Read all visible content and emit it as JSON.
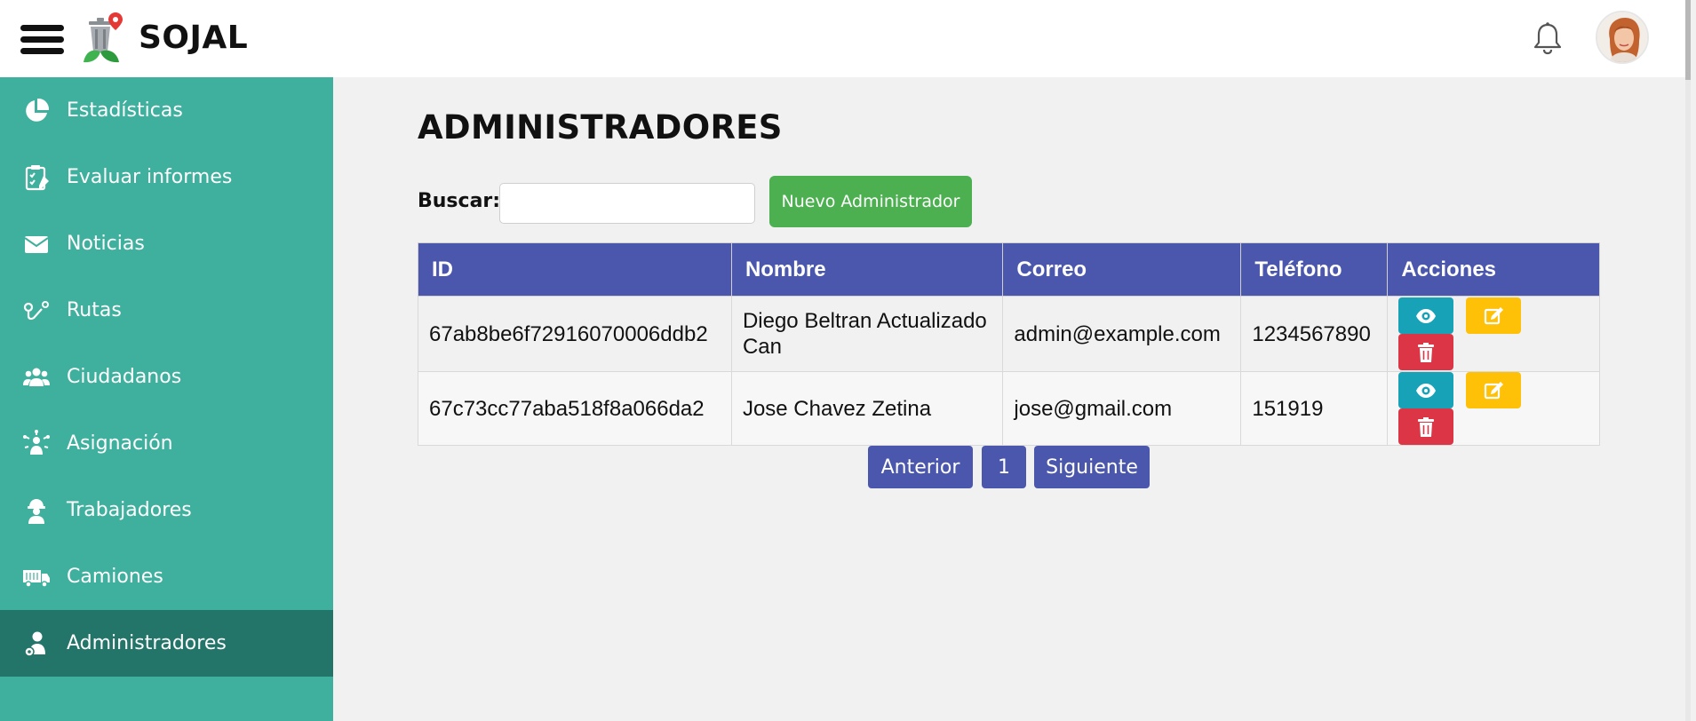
{
  "app": {
    "name": "SOJAL"
  },
  "icons": {
    "menu": "hamburger-icon",
    "logo": "trash-bin-location-logo",
    "notifications": "bell-icon",
    "user": "user-avatar"
  },
  "sidebar": {
    "items": [
      {
        "label": "Estadísticas",
        "icon": "pie-chart-icon",
        "active": false
      },
      {
        "label": "Evaluar informes",
        "icon": "clipboard-check-icon",
        "active": false
      },
      {
        "label": "Noticias",
        "icon": "envelope-icon",
        "active": false
      },
      {
        "label": "Rutas",
        "icon": "route-icon",
        "active": false
      },
      {
        "label": "Ciudadanos",
        "icon": "users-icon",
        "active": false
      },
      {
        "label": "Asignación",
        "icon": "assignment-icon",
        "active": false
      },
      {
        "label": "Trabajadores",
        "icon": "hard-hat-worker-icon",
        "active": false
      },
      {
        "label": "Camiones",
        "icon": "truck-icon",
        "active": false
      },
      {
        "label": "Administradores",
        "icon": "user-cog-icon",
        "active": true
      }
    ]
  },
  "main": {
    "title": "ADMINISTRADORES",
    "search": {
      "label": "Buscar:",
      "value": "",
      "placeholder": ""
    },
    "new_button": "Nuevo Administrador",
    "table": {
      "headers": [
        "ID",
        "Nombre",
        "Correo",
        "Teléfono",
        "Acciones"
      ],
      "rows": [
        {
          "id": "67ab8be6f72916070006ddb2",
          "nombre": "Diego Beltran Actualizado Can",
          "correo": "admin@example.com",
          "telefono": "1234567890"
        },
        {
          "id": "67c73cc77aba518f8a066da2",
          "nombre": "Jose Chavez Zetina",
          "correo": "jose@gmail.com",
          "telefono": "151919"
        }
      ],
      "actions": [
        "eye-icon",
        "edit-icon",
        "trash-icon"
      ]
    },
    "pagination": {
      "prev": "Anterior",
      "page": "1",
      "next": "Siguiente"
    }
  },
  "colors": {
    "sidebar": "#40b09e",
    "sidebar_active": "#237469",
    "table_header": "#4b57ad",
    "new_button": "#4caf50",
    "view": "#17a2b8",
    "edit": "#ffc107",
    "delete": "#dc3545"
  }
}
